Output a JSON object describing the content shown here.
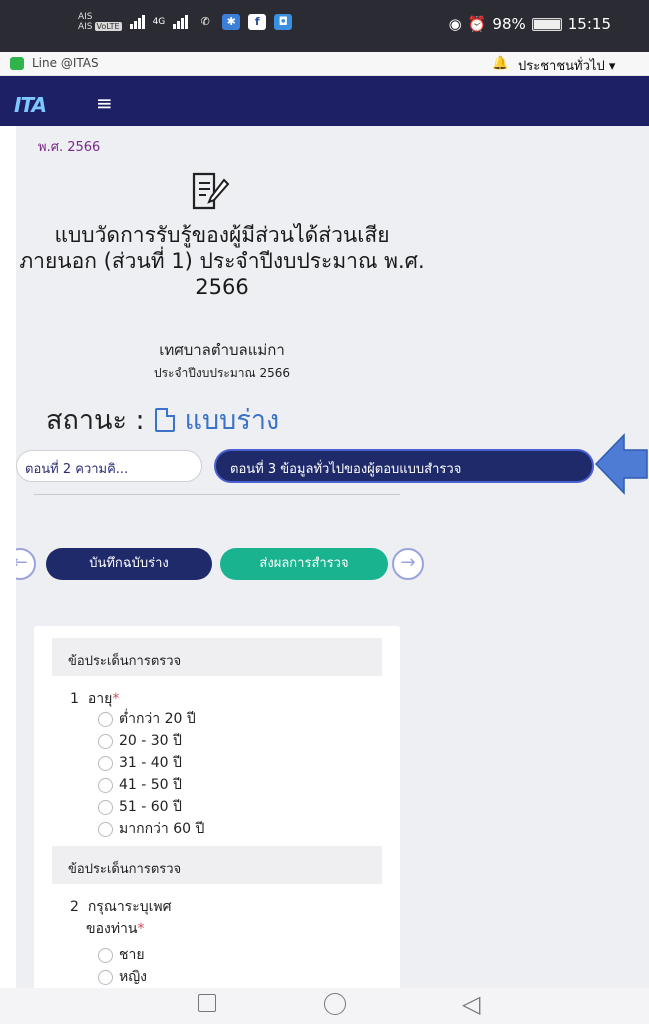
{
  "statusbar": {
    "carrier1": "AIS",
    "carrier2": "AIS",
    "volte": "VoLTE",
    "net": "4G",
    "battery": "98%",
    "time": "15:15"
  },
  "browser": {
    "line_label": "Line @ITAS",
    "role_label": "ประชาชนทั่วไป ▾"
  },
  "navbar": {
    "logo": "ITA"
  },
  "page": {
    "year": "พ.ศ. 2566",
    "title": "แบบวัดการรับรู้ของผู้มีส่วนได้ส่วนเสียภายนอก (ส่วนที่ 1) ประจำปีงบประมาณ พ.ศ. 2566",
    "org": "เทศบาลตำบลแม่กา",
    "budget": "ประจำปีงบประมาณ 2566",
    "status_label": "สถานะ :",
    "status_value": "แบบร่าง"
  },
  "tabs": {
    "tab_prev": "ตอนที่ 2 ความคิ...",
    "tab_active": "ตอนที่ 3 ข้อมูลทั่วไปของผู้ตอบแบบสำรวจ"
  },
  "actions": {
    "prev_icon": "arrow-left-icon",
    "save": "บันทึกฉบับร่าง",
    "submit": "ส่งผลการสำรวจ",
    "next_icon": "arrow-right-icon"
  },
  "form": {
    "section_label": "ข้อประเด็นการตรวจ",
    "q1": {
      "number": "1",
      "text": "อายุ",
      "required_mark": "*",
      "options": [
        "ต่ำกว่า 20 ปี",
        "20 - 30 ปี",
        "31 - 40 ปี",
        "41 - 50 ปี",
        "51 - 60 ปี",
        "มากกว่า 60 ปี"
      ]
    },
    "q2": {
      "number": "2",
      "text_line1": "กรุณาระบุเพศ",
      "text_line2": "ของท่าน",
      "required_mark": "*",
      "options": [
        "ชาย",
        "หญิง"
      ]
    }
  },
  "colors": {
    "navbar": "#1e2066",
    "primary_button": "#1f2a6b",
    "submit_button": "#19b38f",
    "status_value": "#3a73c9",
    "arrow_annotation": "#4e7bd4"
  }
}
